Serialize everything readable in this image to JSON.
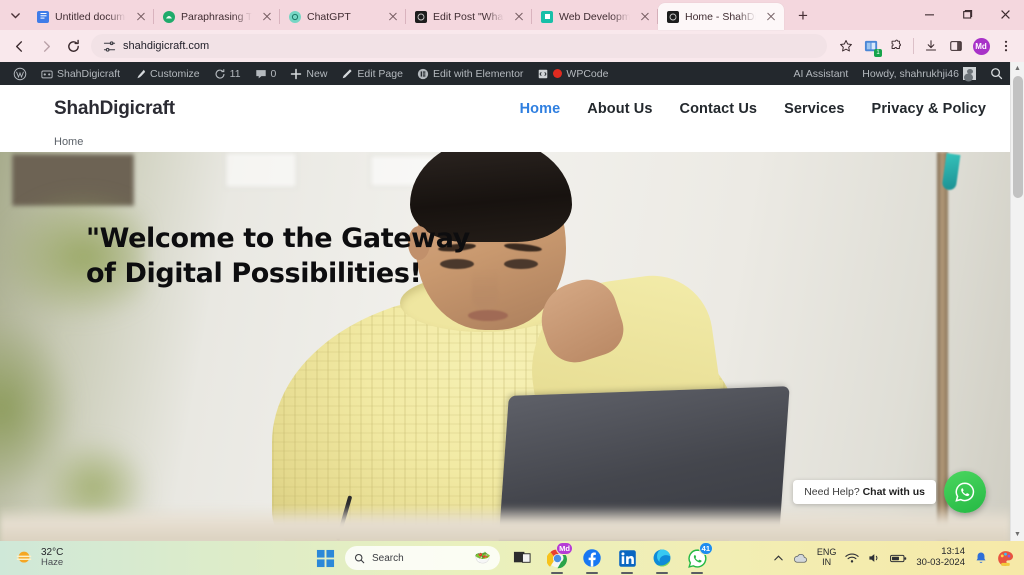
{
  "browser": {
    "tabs": [
      {
        "title": "Untitled document -",
        "favicon": "google-docs-icon",
        "color": "#3f7ce8",
        "active": false
      },
      {
        "title": "Paraphrasing Tool - Q",
        "favicon": "quillbot-icon",
        "color": "#1fab6b",
        "active": false
      },
      {
        "title": "ChatGPT",
        "favicon": "chatgpt-icon",
        "color": "#76d6c4",
        "active": false
      },
      {
        "title": "Edit Post \"What is We",
        "favicon": "wordpress-icon",
        "color": "#1d1d1d",
        "active": false
      },
      {
        "title": "Web Development In",
        "favicon": "docs-blue-icon",
        "color": "#18bfa8",
        "active": false
      },
      {
        "title": "Home - ShahDigicraft",
        "favicon": "wordpress-icon",
        "color": "#1d1d1d",
        "active": true
      }
    ],
    "new_tab_label": "+",
    "window_controls": {
      "minimize": "minimize-button",
      "maximize": "maximize-button",
      "close": "close-button"
    },
    "toolbar": {
      "back": "back-button",
      "forward": "forward-button",
      "reload": "reload-button",
      "url": "shahdigicraft.com",
      "site_info": "site-settings-icon",
      "bookmark": "star-icon",
      "extensions": [
        "grammarly-extension-icon",
        "extensions-puzzle-icon"
      ],
      "downloads": "download-icon",
      "side_panel": "side-panel-icon",
      "profile_initials": "Md",
      "menu": "three-dot-menu-icon"
    }
  },
  "wpadminbar": {
    "logo": "wordpress-logo-icon",
    "items": [
      {
        "label": "ShahDigicraft",
        "icon": "dashboard-icon"
      },
      {
        "label": "Customize",
        "icon": "paintbrush-icon"
      },
      {
        "label": "11",
        "icon": "updates-icon"
      },
      {
        "label": "0",
        "icon": "comments-icon"
      },
      {
        "label": "New",
        "icon": "plus-icon"
      },
      {
        "label": "Edit Page",
        "icon": "pencil-icon"
      },
      {
        "label": "Edit with Elementor",
        "icon": "elementor-icon"
      },
      {
        "label": "WPCode",
        "icon": "wpcode-icon"
      }
    ],
    "ai_assistant": "AI Assistant",
    "howdy": "Howdy, shahrukhji46",
    "avatar": "user-avatar",
    "search": "search-icon"
  },
  "site": {
    "brand": "ShahDigicraft",
    "nav": [
      {
        "label": "Home",
        "current": true
      },
      {
        "label": "About Us",
        "current": false
      },
      {
        "label": "Contact Us",
        "current": false
      },
      {
        "label": "Services",
        "current": false
      },
      {
        "label": "Privacy & Policy",
        "current": false
      }
    ],
    "breadcrumb": "Home",
    "hero": {
      "title": "\"Welcome to the Gateway\nof Digital Possibilities!",
      "image_alt": "woman-in-yellow-sweater-working-on-laptop"
    },
    "whatsapp_widget": {
      "prefix": "Need Help? ",
      "bold": "Chat with us",
      "button": "whatsapp-icon"
    }
  },
  "taskbar": {
    "weather": {
      "temp": "32°C",
      "condition": "Haze",
      "icon": "haze-sun-icon"
    },
    "start": "windows-start-icon",
    "search_placeholder": "Search",
    "search_emoji": "🥗",
    "apps": [
      {
        "name": "task-view",
        "badge": ""
      },
      {
        "name": "google-chrome",
        "badge": "Md"
      },
      {
        "name": "facebook",
        "badge": ""
      },
      {
        "name": "linkedin",
        "badge": ""
      },
      {
        "name": "microsoft-edge",
        "badge": ""
      },
      {
        "name": "whatsapp",
        "badge": "41"
      }
    ],
    "tray": {
      "overflow": "show-hidden-icons-chevron",
      "cloud": "onedrive-icon",
      "language": "ENG",
      "region": "IN",
      "wifi": "wifi-icon",
      "volume": "volume-icon",
      "battery": "battery-icon",
      "time": "13:14",
      "date": "30-03-2024",
      "notifications": "bell-icon",
      "paint": "paint-app-icon"
    }
  },
  "colors": {
    "chrome_theme": "#f4d7de",
    "wp_bar": "#23282d",
    "nav_active": "#2f7fe0",
    "whatsapp_green": "#25b944"
  }
}
